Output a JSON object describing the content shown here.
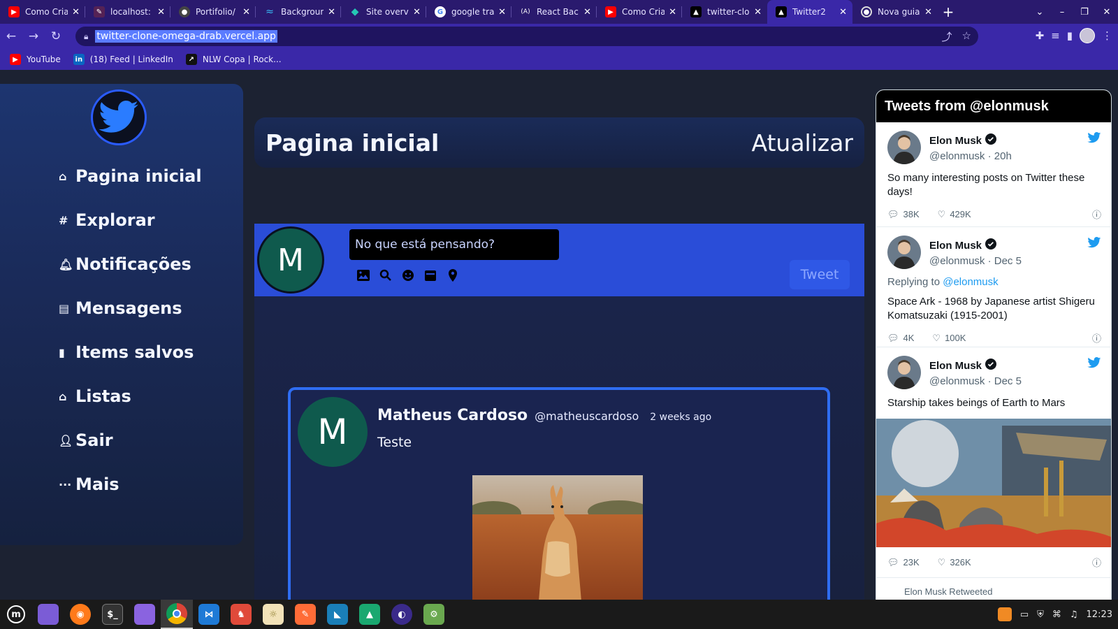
{
  "browser": {
    "tabs": [
      {
        "label": "Como Cria",
        "icon": "youtube-icon",
        "color": "#ff0000"
      },
      {
        "label": "localhost:",
        "icon": "dev-icon",
        "color": "#552255"
      },
      {
        "label": "Portifolio/",
        "icon": "github-icon",
        "color": "#444444"
      },
      {
        "label": "Backgroun",
        "icon": "tailwind-icon",
        "color": "#38bdf8"
      },
      {
        "label": "Site overvi",
        "icon": "netlify-icon",
        "color": "#25c7b4"
      },
      {
        "label": "google tra",
        "icon": "google-icon",
        "color": "#ffffff"
      },
      {
        "label": "React Bac",
        "icon": "react-icon",
        "color": "#2a1a6e"
      },
      {
        "label": "Como Cria",
        "icon": "youtube-icon",
        "color": "#ff0000"
      },
      {
        "label": "twitter-clo",
        "icon": "vercel-icon",
        "color": "#000000"
      },
      {
        "label": "Twitter2",
        "icon": "vercel-icon",
        "color": "#000000",
        "active": true
      },
      {
        "label": "Nova guia",
        "icon": "chrome-icon",
        "color": "#555555"
      }
    ],
    "url": "twitter-clone-omega-drab.vercel.app",
    "bookmarks": [
      {
        "label": "YouTube",
        "icon": "youtube-icon",
        "color": "#ff0000"
      },
      {
        "label": "(18) Feed | LinkedIn",
        "icon": "linkedin-icon",
        "color": "#0a66c2"
      },
      {
        "label": "NLW Copa | Rock...",
        "icon": "rocketseat-icon",
        "color": "#111111"
      }
    ]
  },
  "sidebar": {
    "items": [
      {
        "label": "Pagina inicial",
        "icon": "home-icon"
      },
      {
        "label": "Explorar",
        "icon": "hashtag-icon"
      },
      {
        "label": "Notificações",
        "icon": "bell-icon"
      },
      {
        "label": "Mensagens",
        "icon": "message-icon"
      },
      {
        "label": "Items salvos",
        "icon": "bookmark-icon"
      },
      {
        "label": "Listas",
        "icon": "list-icon"
      },
      {
        "label": "Sair",
        "icon": "user-icon"
      },
      {
        "label": "Mais",
        "icon": "more-icon"
      }
    ]
  },
  "header": {
    "title": "Pagina inicial",
    "refresh": "Atualizar"
  },
  "composer": {
    "avatar_letter": "M",
    "placeholder": "No que está pensando?",
    "tweet_button": "Tweet"
  },
  "post": {
    "avatar_letter": "M",
    "name": "Matheus Cardoso",
    "handle": "@matheuscardoso",
    "time": "2 weeks ago",
    "text": "Teste"
  },
  "embed": {
    "title": "Tweets from @elonmusk",
    "tweets": [
      {
        "name": "Elon Musk",
        "meta": "@elonmusk · 20h",
        "reply_prefix": "",
        "reply_to": "",
        "text": "So many interesting posts on Twitter these days!",
        "replies": "38K",
        "likes": "429K"
      },
      {
        "name": "Elon Musk",
        "meta": "@elonmusk · Dec 5",
        "reply_prefix": "Replying to ",
        "reply_to": "@elonmusk",
        "text": "Space Ark - 1968 by Japanese artist Shigeru Komatsuzaki (1915-2001)",
        "replies": "4K",
        "likes": "100K"
      },
      {
        "name": "Elon Musk",
        "meta": "@elonmusk · Dec 5",
        "reply_prefix": "",
        "reply_to": "",
        "text": "Starship takes beings of Earth to Mars",
        "replies": "23K",
        "likes": "326K"
      }
    ],
    "more": "Elon Musk Retweeted"
  },
  "taskbar": {
    "apps": [
      {
        "name": "mint-menu-icon",
        "color": "#222222"
      },
      {
        "name": "files-icon",
        "color": "#7b5cd6"
      },
      {
        "name": "firefox-icon",
        "color": "#ff7a1a"
      },
      {
        "name": "terminal-icon",
        "color": "#333333"
      },
      {
        "name": "folder-icon",
        "color": "#8a63e0"
      },
      {
        "name": "chrome-icon",
        "color": "#e8b21a",
        "active": true
      },
      {
        "name": "vscode-icon",
        "color": "#1e7ad6"
      },
      {
        "name": "gitkraken-icon",
        "color": "#e04a3a"
      },
      {
        "name": "settings-icon",
        "color": "#f2e2b8"
      },
      {
        "name": "postman-icon",
        "color": "#ff6c37"
      },
      {
        "name": "mysql-workbench-icon",
        "color": "#1a7fb8"
      },
      {
        "name": "beekeeper-icon",
        "color": "#1aa870"
      },
      {
        "name": "eclipse-icon",
        "color": "#3a2a8a"
      },
      {
        "name": "android-studio-icon",
        "color": "#6aa84f"
      }
    ],
    "clock": "12:23"
  },
  "colors": {
    "accent": "#2a4dd8",
    "sidebar": "#1d3570",
    "border": "#2f6df2"
  }
}
